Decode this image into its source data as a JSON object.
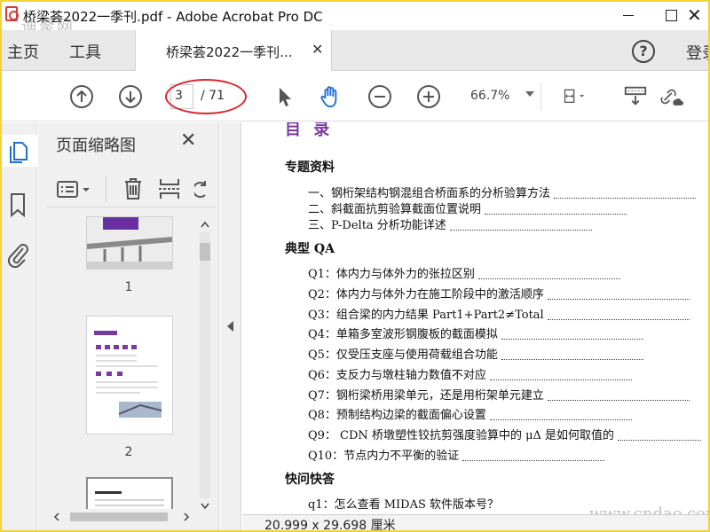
{
  "window": {
    "title": "桥梁荟2022一季刊.pdf - Adobe Acrobat Pro DC",
    "watermark_top": "迪聚网",
    "watermark_bottom": "www.cndao.com"
  },
  "tabbar": {
    "home": "主页",
    "tools": "工具",
    "doc_tab": "桥梁荟2022一季刊...",
    "login": "登录"
  },
  "toolbar": {
    "page_current": "3",
    "page_total": "/ 71",
    "zoom": "66.7%"
  },
  "thumbnails": {
    "title": "页面缩略图",
    "pages": [
      "1",
      "2"
    ]
  },
  "document": {
    "toc_heading": "目 录",
    "sections": [
      {
        "title": "专题资料",
        "items": [
          "一、钢桁架结构钢混组合桥面系的分析验算方法",
          "二、斜截面抗剪验算截面位置说明",
          "三、P-Delta 分析功能详述"
        ]
      },
      {
        "title": "典型 QA",
        "items": [
          "Q1：体内力与体外力的张拉区别",
          "Q2：体内力与体外力在施工阶段中的激活顺序",
          "Q3：组合梁的内力结果 Part1+Part2≠Total",
          "Q4：单箱多室波形钢腹板的截面模拟",
          "Q5：仅受压支座与使用荷载组合功能",
          "Q6：支反力与墩柱轴力数值不对应",
          "Q7：钢桁梁桥用梁单元，还是用桁架单元建立",
          "Q8：预制结构边梁的截面偏心设置",
          "Q9：  CDN 桥墩塑性铰抗剪强度验算中的 μΔ 是如何取值的",
          "Q10：节点内力不平衡的验证"
        ]
      },
      {
        "title": "快问快答",
        "items": [
          "q1：怎么查看 MIDAS 软件版本号？"
        ]
      }
    ]
  },
  "status": {
    "page_size": "20.999 x 29.698 厘米"
  },
  "colors": {
    "highlight_ellipse": "#d9262b",
    "toc_heading": "#7a3aa0",
    "frame_border": "#f2d33a"
  }
}
